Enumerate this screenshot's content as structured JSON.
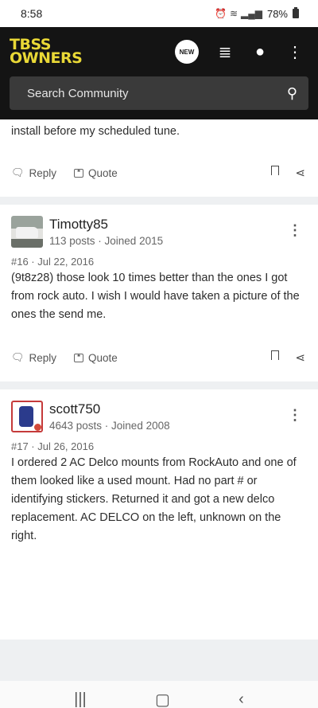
{
  "status": {
    "time": "8:58",
    "battery": "78%"
  },
  "header": {
    "logo_line1": "TBSS",
    "logo_line2": "OWNERS",
    "new_badge": "NEW"
  },
  "search": {
    "placeholder": "Search Community"
  },
  "prev_post": {
    "text_tail": "install before my scheduled tune."
  },
  "actions": {
    "reply": "Reply",
    "quote": "Quote"
  },
  "posts": [
    {
      "username": "Timotty85",
      "stats": "113 posts · Joined 2015",
      "meta": "#16 · Jul 22, 2016",
      "text": "(9t8z28) those look 10 times better than the ones I got from rock auto. I wish I would have taken a picture of the ones the send me."
    },
    {
      "username": "scott750",
      "stats": "4643 posts · Joined 2008",
      "meta": "#17 · Jul 26, 2016",
      "text": "I ordered 2 AC Delco mounts from RockAuto and one of them looked like a used mount. Had no part # or identifying stickers. Returned it and got a new delco replacement. AC DELCO on the left, unknown on the right."
    }
  ],
  "icons": {
    "new": "new-icon",
    "list": "list-icon",
    "user": "user-icon",
    "menu": "kebab-menu-icon",
    "search": "search-icon",
    "reply": "reply-icon",
    "quote": "quote-icon",
    "bookmark": "bookmark-icon",
    "share": "share-icon"
  },
  "colors": {
    "logo": "#e9d836",
    "header_bg": "#141414",
    "search_bg": "#3a3a3a",
    "separator": "#eef0f2"
  }
}
